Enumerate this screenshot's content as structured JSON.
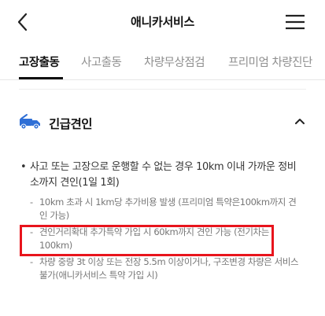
{
  "header": {
    "title": "애니카서비스",
    "back_icon": "chevron-left-icon",
    "menu_icon": "hamburger-menu-icon"
  },
  "tabs": [
    {
      "label": "고장출동",
      "active": true
    },
    {
      "label": "사고출동",
      "active": false
    },
    {
      "label": "차량무상점검",
      "active": false
    },
    {
      "label": "프리미엄 차량진단",
      "active": false
    }
  ],
  "accordion": {
    "title": "긴급견인",
    "icon": "tow-truck-icon",
    "expanded": true,
    "toggle_icon": "chevron-up-icon",
    "main_bullet": "사고 또는 고장으로 운행할 수 없는 경우 10km 이내 가까운 정비소까지 견인(1일 1회)",
    "sub_items": [
      "10km 초과 시 1km당 추가비용 발생 (프리미엄 특약은100km까지 견인 가능)",
      "견인거리확대 추가특약 가입 시 60km까지 견인 가능 (전기차는 100km)",
      "차량 중량 3t 이상 또는 전장 5.5m 이상이거나, 구조변경 차량은 서비스 불가(애니카서비스 특약 가입 시)"
    ]
  },
  "colors": {
    "accent_blue": "#2f6fd6",
    "highlight_red": "#e8141c",
    "active_tab": "#111111",
    "inactive_tab": "#8f8f8f"
  }
}
